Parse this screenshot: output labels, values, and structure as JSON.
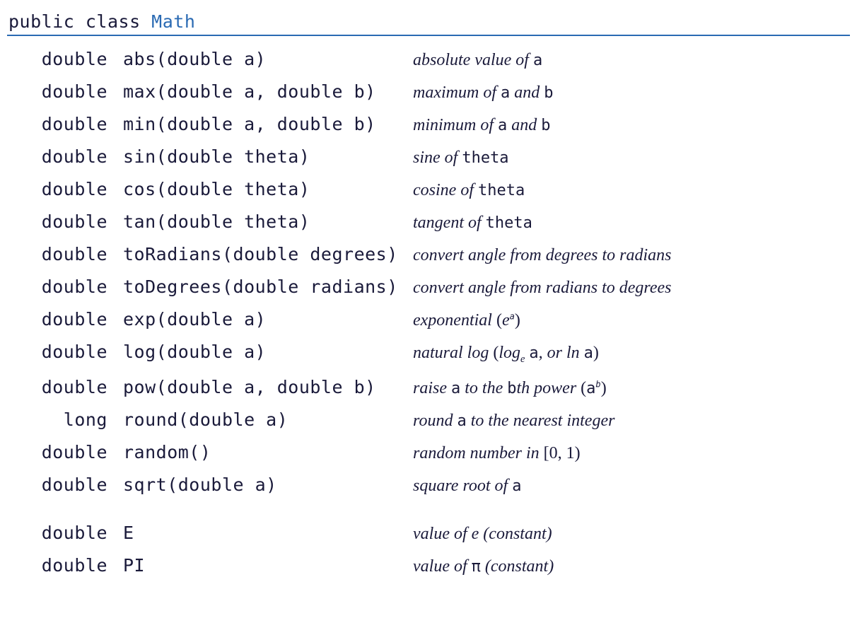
{
  "header": {
    "prefix": "public class ",
    "classname": "Math"
  },
  "rows": [
    {
      "ret": "double",
      "sig": "abs(double a)",
      "desc": "absolute value of <span class=\"tt\">a</span>"
    },
    {
      "ret": "double",
      "sig": "max(double a, double b)",
      "desc": "maximum of <span class=\"tt\">a</span> and <span class=\"tt\">b</span>"
    },
    {
      "ret": "double",
      "sig": "min(double a, double b)",
      "desc": "minimum of <span class=\"tt\">a</span> and <span class=\"tt\">b</span>"
    },
    {
      "ret": "double",
      "sig": "sin(double theta)",
      "desc": "sine of <span class=\"tt\">theta</span>"
    },
    {
      "ret": "double",
      "sig": "cos(double theta)",
      "desc": "cosine of <span class=\"tt\">theta</span>"
    },
    {
      "ret": "double",
      "sig": "tan(double theta)",
      "desc": "tangent of <span class=\"tt\">theta</span>"
    },
    {
      "ret": "double",
      "sig": "toRadians(double degrees)",
      "desc": "convert angle from degrees to radians"
    },
    {
      "ret": "double",
      "sig": "toDegrees(double radians)",
      "desc": "convert angle from radians to degrees"
    },
    {
      "ret": "double",
      "sig": "exp(double a)",
      "desc": "exponential <span class=\"serif-up\">(</span>e<span class=\"mono-it\"><sup>a</sup></span><span class=\"serif-up\">)</span>"
    },
    {
      "ret": "double",
      "sig": "log(double a)",
      "desc": "natural log <span class=\"serif-up\">(</span>log<sub>e</sub> <span class=\"tt\">a</span>, or ln <span class=\"tt\">a</span><span class=\"serif-up\">)</span>"
    },
    {
      "ret": "double",
      "sig": "pow(double a, double b)",
      "desc": "raise <span class=\"tt\">a</span> to the <span class=\"tt\">b</span>th power <span class=\"serif-up\">(</span><span class=\"tt\">a</span><span class=\"mono-it\"><sup>b</sup></span><span class=\"serif-up\">)</span>"
    },
    {
      "ret": "long",
      "sig": "round(double a)",
      "desc": "round <span class=\"tt\">a</span>  to the nearest integer"
    },
    {
      "ret": "double",
      "sig": "random()",
      "desc": "random number in <span class=\"serif-up\">[0, 1)</span>"
    },
    {
      "ret": "double",
      "sig": "sqrt(double a)",
      "desc": "square root of <span class=\"tt\">a</span>"
    },
    {
      "gap": true
    },
    {
      "ret": "double",
      "sig": "E",
      "desc": "value of e (constant)"
    },
    {
      "ret": "double",
      "sig": "PI",
      "desc": "value of <span class=\"tt\">&pi;</span> (constant)"
    }
  ]
}
